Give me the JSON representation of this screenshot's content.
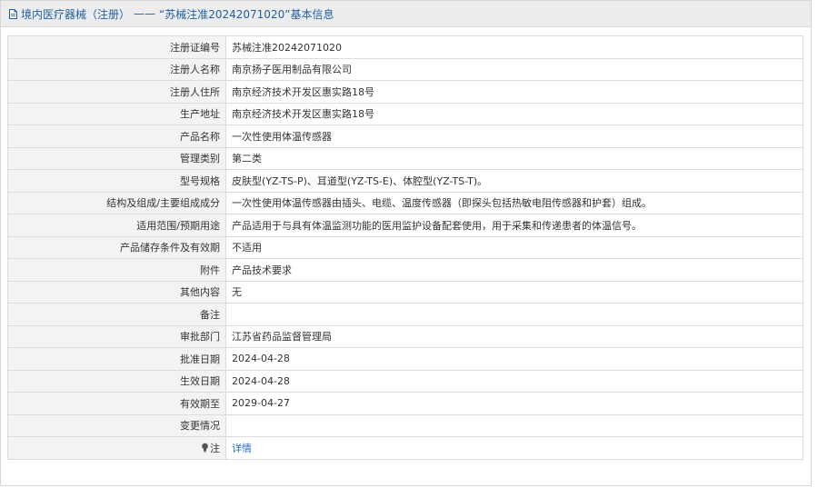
{
  "header": {
    "category": "境内医疗器械（注册）",
    "separator": "——",
    "record": "“苏械注准20242071020”",
    "suffix": "基本信息"
  },
  "rows": [
    {
      "label": "注册证编号",
      "value": "苏械注准20242071020"
    },
    {
      "label": "注册人名称",
      "value": "南京扬子医用制品有限公司"
    },
    {
      "label": "注册人住所",
      "value": "南京经济技术开发区惠实路18号"
    },
    {
      "label": "生产地址",
      "value": "南京经济技术开发区惠实路18号"
    },
    {
      "label": "产品名称",
      "value": "一次性使用体温传感器"
    },
    {
      "label": "管理类别",
      "value": "第二类"
    },
    {
      "label": "型号规格",
      "value": "皮肤型(YZ-TS-P)、耳道型(YZ-TS-E)、体腔型(YZ-TS-T)。"
    },
    {
      "label": "结构及组成/主要组成成分",
      "value": "一次性使用体温传感器由插头、电缆、温度传感器（即探头包括热敏电阻传感器和护套）组成。"
    },
    {
      "label": "适用范围/预期用途",
      "value": "产品适用于与具有体温监测功能的医用监护设备配套使用，用于采集和传递患者的体温信号。"
    },
    {
      "label": "产品储存条件及有效期",
      "value": "不适用"
    },
    {
      "label": "附件",
      "value": "产品技术要求"
    },
    {
      "label": "其他内容",
      "value": "无"
    },
    {
      "label": "备注",
      "value": ""
    },
    {
      "label": "审批部门",
      "value": "江苏省药品监督管理局"
    },
    {
      "label": "批准日期",
      "value": "2024-04-28"
    },
    {
      "label": "生效日期",
      "value": "2024-04-28"
    },
    {
      "label": "有效期至",
      "value": "2029-04-27"
    },
    {
      "label": "变更情况",
      "value": ""
    }
  ],
  "note": {
    "label": "注",
    "link_text": "详情"
  },
  "colors": {
    "header_text": "#1f5f9f",
    "link": "#2a6fc0",
    "label_bg": "#f3f3f3",
    "border": "#dcdcdc"
  },
  "icons": {
    "header": "document-icon",
    "note": "lightbulb-icon"
  }
}
